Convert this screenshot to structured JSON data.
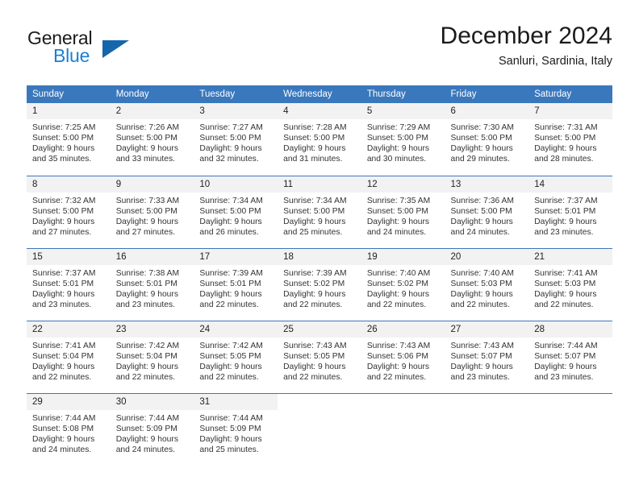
{
  "logo": {
    "word1": "General",
    "word2": "Blue",
    "triangle_color": "#1666ad",
    "blue_color": "#1b7fd4"
  },
  "header": {
    "title": "December 2024",
    "subtitle": "Sanluri, Sardinia, Italy"
  },
  "theme": {
    "header_blue": "#3a78bd",
    "daynum_gray": "#f2f2f2",
    "text": "#333333"
  },
  "weekday_headers": [
    "Sunday",
    "Monday",
    "Tuesday",
    "Wednesday",
    "Thursday",
    "Friday",
    "Saturday"
  ],
  "labels": {
    "sunrise": "Sunrise:",
    "sunset": "Sunset:",
    "daylight": "Daylight:"
  },
  "weeks": [
    {
      "days": [
        {
          "num": "1",
          "sunrise": "Sunrise: 7:25 AM",
          "sunset": "Sunset: 5:00 PM",
          "daylight1": "Daylight: 9 hours",
          "daylight2": "and 35 minutes."
        },
        {
          "num": "2",
          "sunrise": "Sunrise: 7:26 AM",
          "sunset": "Sunset: 5:00 PM",
          "daylight1": "Daylight: 9 hours",
          "daylight2": "and 33 minutes."
        },
        {
          "num": "3",
          "sunrise": "Sunrise: 7:27 AM",
          "sunset": "Sunset: 5:00 PM",
          "daylight1": "Daylight: 9 hours",
          "daylight2": "and 32 minutes."
        },
        {
          "num": "4",
          "sunrise": "Sunrise: 7:28 AM",
          "sunset": "Sunset: 5:00 PM",
          "daylight1": "Daylight: 9 hours",
          "daylight2": "and 31 minutes."
        },
        {
          "num": "5",
          "sunrise": "Sunrise: 7:29 AM",
          "sunset": "Sunset: 5:00 PM",
          "daylight1": "Daylight: 9 hours",
          "daylight2": "and 30 minutes."
        },
        {
          "num": "6",
          "sunrise": "Sunrise: 7:30 AM",
          "sunset": "Sunset: 5:00 PM",
          "daylight1": "Daylight: 9 hours",
          "daylight2": "and 29 minutes."
        },
        {
          "num": "7",
          "sunrise": "Sunrise: 7:31 AM",
          "sunset": "Sunset: 5:00 PM",
          "daylight1": "Daylight: 9 hours",
          "daylight2": "and 28 minutes."
        }
      ]
    },
    {
      "days": [
        {
          "num": "8",
          "sunrise": "Sunrise: 7:32 AM",
          "sunset": "Sunset: 5:00 PM",
          "daylight1": "Daylight: 9 hours",
          "daylight2": "and 27 minutes."
        },
        {
          "num": "9",
          "sunrise": "Sunrise: 7:33 AM",
          "sunset": "Sunset: 5:00 PM",
          "daylight1": "Daylight: 9 hours",
          "daylight2": "and 27 minutes."
        },
        {
          "num": "10",
          "sunrise": "Sunrise: 7:34 AM",
          "sunset": "Sunset: 5:00 PM",
          "daylight1": "Daylight: 9 hours",
          "daylight2": "and 26 minutes."
        },
        {
          "num": "11",
          "sunrise": "Sunrise: 7:34 AM",
          "sunset": "Sunset: 5:00 PM",
          "daylight1": "Daylight: 9 hours",
          "daylight2": "and 25 minutes."
        },
        {
          "num": "12",
          "sunrise": "Sunrise: 7:35 AM",
          "sunset": "Sunset: 5:00 PM",
          "daylight1": "Daylight: 9 hours",
          "daylight2": "and 24 minutes."
        },
        {
          "num": "13",
          "sunrise": "Sunrise: 7:36 AM",
          "sunset": "Sunset: 5:00 PM",
          "daylight1": "Daylight: 9 hours",
          "daylight2": "and 24 minutes."
        },
        {
          "num": "14",
          "sunrise": "Sunrise: 7:37 AM",
          "sunset": "Sunset: 5:01 PM",
          "daylight1": "Daylight: 9 hours",
          "daylight2": "and 23 minutes."
        }
      ]
    },
    {
      "days": [
        {
          "num": "15",
          "sunrise": "Sunrise: 7:37 AM",
          "sunset": "Sunset: 5:01 PM",
          "daylight1": "Daylight: 9 hours",
          "daylight2": "and 23 minutes."
        },
        {
          "num": "16",
          "sunrise": "Sunrise: 7:38 AM",
          "sunset": "Sunset: 5:01 PM",
          "daylight1": "Daylight: 9 hours",
          "daylight2": "and 23 minutes."
        },
        {
          "num": "17",
          "sunrise": "Sunrise: 7:39 AM",
          "sunset": "Sunset: 5:01 PM",
          "daylight1": "Daylight: 9 hours",
          "daylight2": "and 22 minutes."
        },
        {
          "num": "18",
          "sunrise": "Sunrise: 7:39 AM",
          "sunset": "Sunset: 5:02 PM",
          "daylight1": "Daylight: 9 hours",
          "daylight2": "and 22 minutes."
        },
        {
          "num": "19",
          "sunrise": "Sunrise: 7:40 AM",
          "sunset": "Sunset: 5:02 PM",
          "daylight1": "Daylight: 9 hours",
          "daylight2": "and 22 minutes."
        },
        {
          "num": "20",
          "sunrise": "Sunrise: 7:40 AM",
          "sunset": "Sunset: 5:03 PM",
          "daylight1": "Daylight: 9 hours",
          "daylight2": "and 22 minutes."
        },
        {
          "num": "21",
          "sunrise": "Sunrise: 7:41 AM",
          "sunset": "Sunset: 5:03 PM",
          "daylight1": "Daylight: 9 hours",
          "daylight2": "and 22 minutes."
        }
      ]
    },
    {
      "days": [
        {
          "num": "22",
          "sunrise": "Sunrise: 7:41 AM",
          "sunset": "Sunset: 5:04 PM",
          "daylight1": "Daylight: 9 hours",
          "daylight2": "and 22 minutes."
        },
        {
          "num": "23",
          "sunrise": "Sunrise: 7:42 AM",
          "sunset": "Sunset: 5:04 PM",
          "daylight1": "Daylight: 9 hours",
          "daylight2": "and 22 minutes."
        },
        {
          "num": "24",
          "sunrise": "Sunrise: 7:42 AM",
          "sunset": "Sunset: 5:05 PM",
          "daylight1": "Daylight: 9 hours",
          "daylight2": "and 22 minutes."
        },
        {
          "num": "25",
          "sunrise": "Sunrise: 7:43 AM",
          "sunset": "Sunset: 5:05 PM",
          "daylight1": "Daylight: 9 hours",
          "daylight2": "and 22 minutes."
        },
        {
          "num": "26",
          "sunrise": "Sunrise: 7:43 AM",
          "sunset": "Sunset: 5:06 PM",
          "daylight1": "Daylight: 9 hours",
          "daylight2": "and 22 minutes."
        },
        {
          "num": "27",
          "sunrise": "Sunrise: 7:43 AM",
          "sunset": "Sunset: 5:07 PM",
          "daylight1": "Daylight: 9 hours",
          "daylight2": "and 23 minutes."
        },
        {
          "num": "28",
          "sunrise": "Sunrise: 7:44 AM",
          "sunset": "Sunset: 5:07 PM",
          "daylight1": "Daylight: 9 hours",
          "daylight2": "and 23 minutes."
        }
      ]
    },
    {
      "days": [
        {
          "num": "29",
          "sunrise": "Sunrise: 7:44 AM",
          "sunset": "Sunset: 5:08 PM",
          "daylight1": "Daylight: 9 hours",
          "daylight2": "and 24 minutes."
        },
        {
          "num": "30",
          "sunrise": "Sunrise: 7:44 AM",
          "sunset": "Sunset: 5:09 PM",
          "daylight1": "Daylight: 9 hours",
          "daylight2": "and 24 minutes."
        },
        {
          "num": "31",
          "sunrise": "Sunrise: 7:44 AM",
          "sunset": "Sunset: 5:09 PM",
          "daylight1": "Daylight: 9 hours",
          "daylight2": "and 25 minutes."
        },
        {
          "num": "",
          "sunrise": "",
          "sunset": "",
          "daylight1": "",
          "daylight2": ""
        },
        {
          "num": "",
          "sunrise": "",
          "sunset": "",
          "daylight1": "",
          "daylight2": ""
        },
        {
          "num": "",
          "sunrise": "",
          "sunset": "",
          "daylight1": "",
          "daylight2": ""
        },
        {
          "num": "",
          "sunrise": "",
          "sunset": "",
          "daylight1": "",
          "daylight2": ""
        }
      ]
    }
  ]
}
